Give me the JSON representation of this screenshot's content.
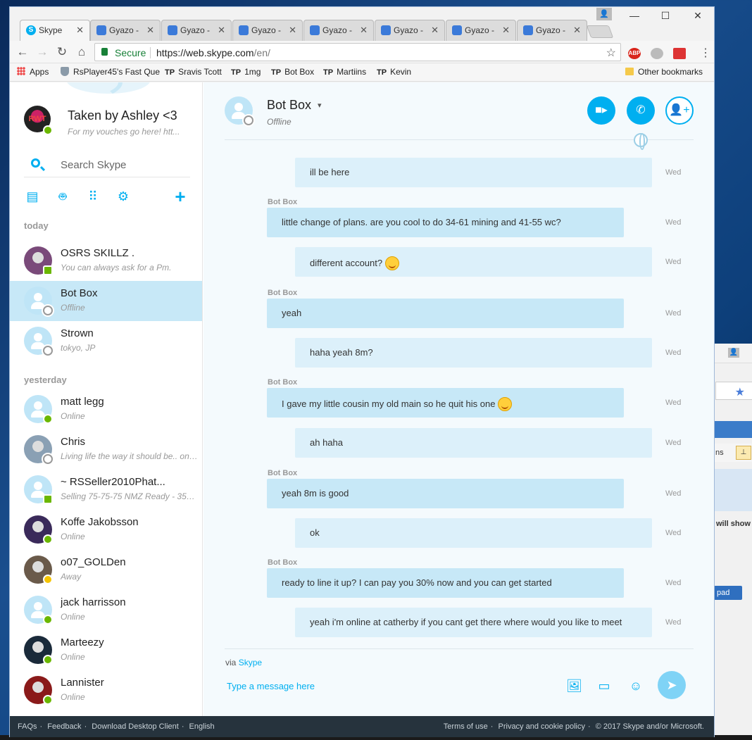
{
  "browser": {
    "tabs": [
      {
        "label": "Skype",
        "active": true,
        "icon": "skype-icon"
      },
      {
        "label": "Gyazo -",
        "active": false,
        "icon": "gyazo-icon"
      },
      {
        "label": "Gyazo -",
        "active": false,
        "icon": "gyazo-icon"
      },
      {
        "label": "Gyazo -",
        "active": false,
        "icon": "gyazo-icon"
      },
      {
        "label": "Gyazo -",
        "active": false,
        "icon": "gyazo-icon"
      },
      {
        "label": "Gyazo -",
        "active": false,
        "icon": "gyazo-icon"
      },
      {
        "label": "Gyazo -",
        "active": false,
        "icon": "gyazo-icon"
      },
      {
        "label": "Gyazo -",
        "active": false,
        "icon": "gyazo-icon"
      }
    ],
    "secure_label": "Secure",
    "url_host": "https://web.skype.com",
    "url_path": "/en/",
    "extensions": [
      "ABP"
    ],
    "bookmarks": {
      "apps": "Apps",
      "items": [
        "RsPlayer45's Fast Que",
        "Sravis Tcott",
        "1mg",
        "Bot Box",
        "Martiins",
        "Kevin"
      ],
      "tp": "TP",
      "other": "Other bookmarks"
    }
  },
  "me": {
    "name": "Taken by Ashley <3",
    "mood": "For my vouches go here! htt...",
    "avatar_text": "RWT"
  },
  "search": {
    "placeholder": "Search Skype"
  },
  "groups": {
    "today": "today",
    "yesterday": "yesterday"
  },
  "contacts": [
    {
      "name": "OSRS SKILLZ .",
      "sub": "You can always ask for a Pm.",
      "status": "mobile",
      "avatar": "photo",
      "color": "#7a4a7a"
    },
    {
      "name": "Bot Box",
      "sub": "Offline",
      "status": "offline",
      "avatar": "generic",
      "selected": true
    },
    {
      "name": "Strown",
      "sub": "tokyo, JP",
      "status": "offline",
      "avatar": "generic"
    },
    {
      "name": "matt legg",
      "sub": "Online",
      "status": "online",
      "avatar": "generic"
    },
    {
      "name": "Chris",
      "sub": "Living life the way it should be.. onl...",
      "status": "offline",
      "avatar": "photo",
      "color": "#8aa0b4"
    },
    {
      "name": "~ RSSeller2010Phat...",
      "sub": "Selling 75-75-75 NMZ Ready - 35M...",
      "status": "mobile",
      "avatar": "generic"
    },
    {
      "name": "Koffe Jakobsson",
      "sub": "Online",
      "status": "online",
      "avatar": "photo",
      "color": "#3a2a5a"
    },
    {
      "name": "o07_GOLDen",
      "sub": "Away",
      "status": "away",
      "avatar": "photo",
      "color": "#6a5a4a"
    },
    {
      "name": "jack harrisson",
      "sub": "Online",
      "status": "online",
      "avatar": "generic"
    },
    {
      "name": "Marteezy",
      "sub": "Online",
      "status": "online",
      "avatar": "photo",
      "color": "#1a2a3a"
    },
    {
      "name": "Lannister",
      "sub": "Online",
      "status": "online",
      "avatar": "photo",
      "color": "#8a1a1a"
    }
  ],
  "chat": {
    "name": "Bot Box",
    "status": "Offline",
    "messages": [
      {
        "dir": "out",
        "text": "ill be here",
        "time": "Wed",
        "sender": ""
      },
      {
        "dir": "in",
        "text": "little change of plans. are you cool to do 34-61 mining and 41-55 wc?",
        "time": "Wed",
        "sender": "Bot Box"
      },
      {
        "dir": "out",
        "text": "different account?",
        "time": "Wed",
        "sender": "",
        "emoji": true
      },
      {
        "dir": "in",
        "text": "yeah",
        "time": "Wed",
        "sender": "Bot Box"
      },
      {
        "dir": "out",
        "text": "haha yeah 8m?",
        "time": "Wed",
        "sender": ""
      },
      {
        "dir": "in",
        "text": "I gave my little cousin my old main so he quit his one",
        "time": "Wed",
        "sender": "Bot Box",
        "emoji": true
      },
      {
        "dir": "out",
        "text": "ah haha",
        "time": "Wed",
        "sender": ""
      },
      {
        "dir": "in",
        "text": "yeah 8m is good",
        "time": "Wed",
        "sender": "Bot Box"
      },
      {
        "dir": "out",
        "text": "ok",
        "time": "Wed",
        "sender": ""
      },
      {
        "dir": "in",
        "text": "ready to line it up? I can pay you 30% now and you can get started",
        "time": "Wed",
        "sender": "Bot Box"
      },
      {
        "dir": "out",
        "text": "yeah i'm online at catherby if you cant get there where would you like to meet",
        "time": "Wed",
        "sender": ""
      }
    ],
    "via_prefix": "via",
    "via_link": "Skype",
    "compose_placeholder": "Type a message here"
  },
  "footer": {
    "left": [
      "FAQs",
      "Feedback",
      "Download Desktop Client",
      "English"
    ],
    "right": [
      "Terms of use",
      "Privacy and cookie policy",
      "© 2017 Skype and/or Microsoft."
    ]
  },
  "desktop": {
    "bg_window_text1": "ns",
    "bg_window_text2": "will show",
    "bg_window_text3": "pad"
  },
  "colors": {
    "accent": "#00aff0",
    "online": "#6bb700",
    "away": "#f5c400",
    "footer": "#26333d",
    "selected": "#c7e8f7"
  }
}
